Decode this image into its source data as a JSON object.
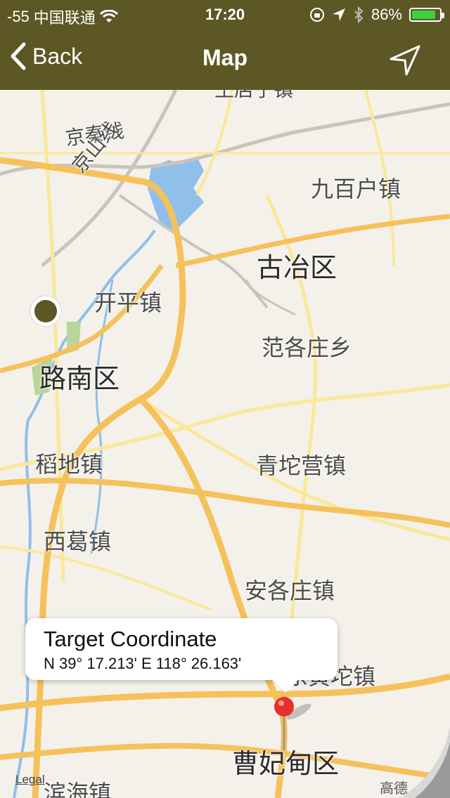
{
  "status_bar": {
    "signal": "-55",
    "carrier": "中国联通",
    "time": "17:20",
    "battery": "86%",
    "battery_level": 0.86
  },
  "nav": {
    "back_label": "Back",
    "title": "Map",
    "locate_icon": "location-arrow-icon"
  },
  "map": {
    "places": [
      {
        "name": "王店子镇",
        "cls": "small"
      },
      {
        "name": "京秦线",
        "cls": "small"
      },
      {
        "name": "京山线",
        "cls": "small"
      },
      {
        "name": "九百户镇",
        "cls": ""
      },
      {
        "name": "古冶区",
        "cls": "big"
      },
      {
        "name": "开平镇",
        "cls": ""
      },
      {
        "name": "范各庄乡",
        "cls": ""
      },
      {
        "name": "路南区",
        "cls": "big"
      },
      {
        "name": "稻地镇",
        "cls": ""
      },
      {
        "name": "青坨营镇",
        "cls": ""
      },
      {
        "name": "西葛镇",
        "cls": ""
      },
      {
        "name": "安各庄镇",
        "cls": ""
      },
      {
        "name": "东黄坨镇",
        "cls": ""
      },
      {
        "name": "曹妃甸区",
        "cls": "big"
      },
      {
        "name": "滨海镇",
        "cls": ""
      }
    ],
    "callout": {
      "title": "Target Coordinate",
      "coordinates": "N 39° 17.213' E 118° 26.163'"
    },
    "legal": "Legal",
    "provider": "高德"
  },
  "colors": {
    "bar": "#5c5725",
    "road_major": "#f5c15a",
    "road_minor": "#fbe79a",
    "water": "#8fbfea",
    "pin": "#e4312c"
  }
}
